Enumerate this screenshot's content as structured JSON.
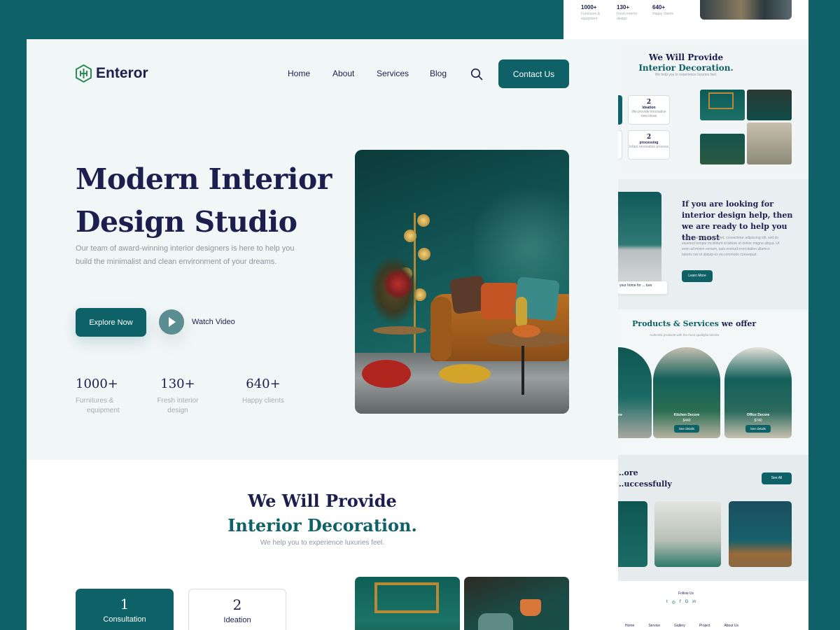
{
  "brand": {
    "name": "Enteror",
    "accent": "#0e6166",
    "navy": "#1c1f4e"
  },
  "nav": {
    "items": [
      "Home",
      "About",
      "Services",
      "Blog"
    ],
    "contact_label": "Contact Us"
  },
  "hero": {
    "title_line1": "Modern Interior",
    "title_line2": "Design Studio",
    "subtitle": "Our team of award-winning interior designers is here to help you build the minimalist and clean environment of your dreams.",
    "explore_label": "Explore Now",
    "watch_label": "Watch Video",
    "stats": [
      {
        "number": "1000+",
        "label_1": "Furnitures &",
        "label_2": "equipment"
      },
      {
        "number": "130+",
        "label_1": "Fresh interior",
        "label_2": "design"
      },
      {
        "number": "640+",
        "label_1": "Happy clients",
        "label_2": ""
      }
    ]
  },
  "provide": {
    "title_line1": "We Will Provide",
    "title_line2": "Interior Decoration.",
    "subtitle": "We help you to experience luxuries feel.",
    "cards": [
      {
        "number": "1",
        "label": "Consultation"
      },
      {
        "number": "2",
        "label": "Ideation"
      }
    ]
  },
  "preview": {
    "stats": [
      {
        "number": "1000+",
        "label_1": "Furnitures &",
        "label_2": "equipment"
      },
      {
        "number": "130+",
        "label_1": "Fresh interior",
        "label_2": "design"
      },
      {
        "number": "640+",
        "label_1": "Happy clients",
        "label_2": ""
      }
    ],
    "provide_title_1": "We Will Provide",
    "provide_title_2": "Interior Decoration.",
    "provide_sub": "We help you to experience luxuries feel.",
    "boxes": [
      {
        "number": "2",
        "title": "Ideation",
        "text": "We provide innovative new ideas"
      },
      {
        "number": "2",
        "title": "processing",
        "text": "Infant renovation process"
      }
    ],
    "help_title": "If you are looking for interior design help, then we are ready to help you the most",
    "help_body": "Lorem ipsum dolor sit amet, consectetur adipiscing elit, sed do eiusmod tempor incididunt ut labore et dolore magna aliqua. Ut enim ad minim veniam, quis nostrud exercitation ullamco laboris nisi ut aliquip ex ea commodo consequat.",
    "learn_label": "Learn More",
    "chip_text": "your home for ... ture",
    "products_title_a": "Products & Services",
    "products_title_b": " we offer",
    "products_sub": "Authentic products with the most qualityful service",
    "products": [
      {
        "name": "...ore",
        "price": "",
        "button": "...ails"
      },
      {
        "name": "Kitchen Decore",
        "price": "$440",
        "button": "See details"
      },
      {
        "name": "Office Decore",
        "price": "$740",
        "button": "See details"
      }
    ],
    "projects_title_1": "...ore",
    "projects_title_2": "...uccessfully",
    "see_all_label": "See All",
    "follow_label": "Follow Us",
    "social": [
      "t",
      "◎",
      "f",
      "G",
      "in"
    ],
    "footer_nav": [
      "Home",
      "Service",
      "Gallery",
      "Project",
      "About Us"
    ]
  }
}
